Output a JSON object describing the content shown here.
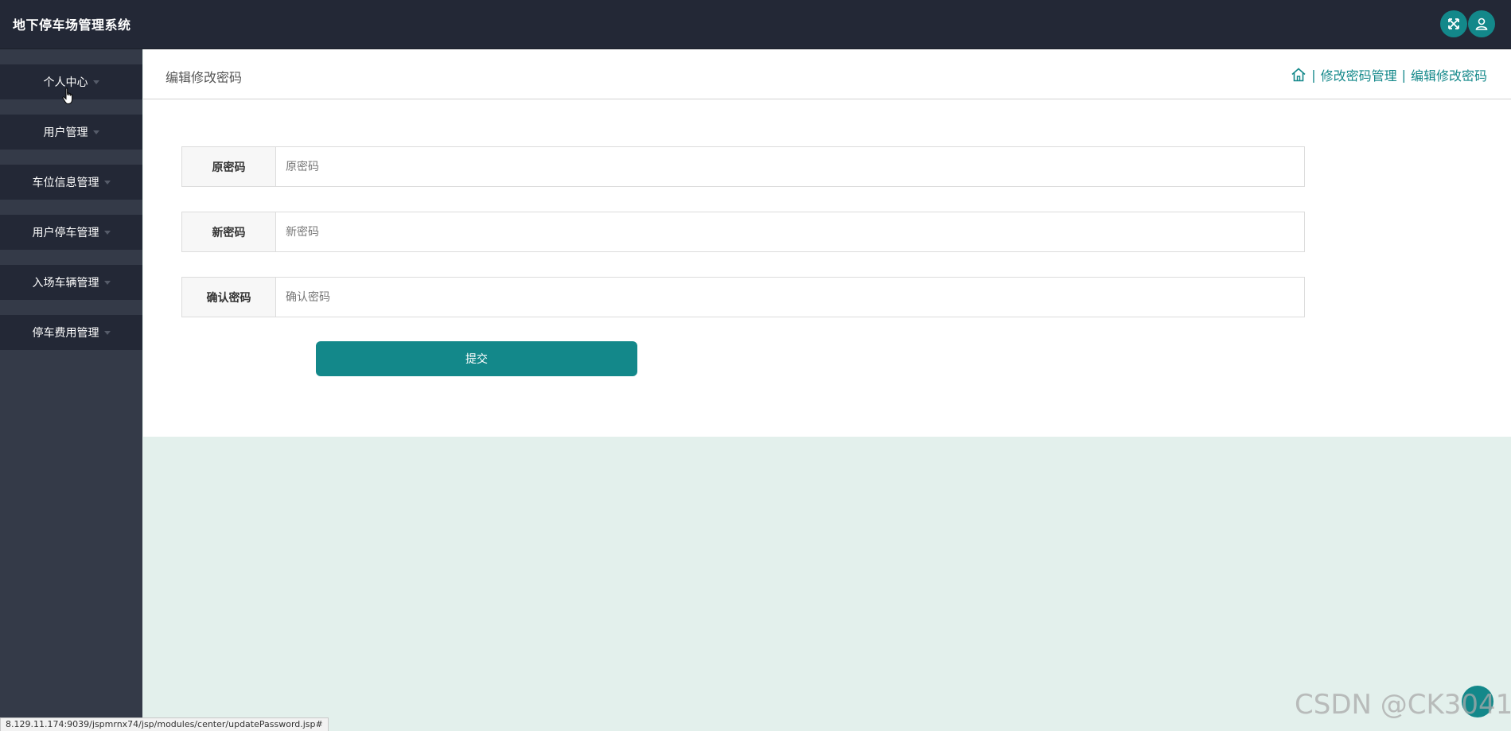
{
  "app": {
    "title": "地下停车场管理系统"
  },
  "header_actions": {
    "fullscreen_icon": "fullscreen-icon",
    "user_icon": "user-icon"
  },
  "sidebar": {
    "items": [
      {
        "label": "个人中心"
      },
      {
        "label": "用户管理"
      },
      {
        "label": "车位信息管理"
      },
      {
        "label": "用户停车管理"
      },
      {
        "label": "入场车辆管理"
      },
      {
        "label": "停车费用管理"
      }
    ]
  },
  "main": {
    "page_title": "编辑修改密码",
    "breadcrumb": {
      "home_icon": "home-icon",
      "items": [
        "修改密码管理",
        "编辑修改密码"
      ],
      "separator": "|"
    }
  },
  "form": {
    "fields": [
      {
        "label": "原密码",
        "placeholder": "原密码",
        "value": ""
      },
      {
        "label": "新密码",
        "placeholder": "新密码",
        "value": ""
      },
      {
        "label": "确认密码",
        "placeholder": "确认密码",
        "value": ""
      }
    ],
    "submit_label": "提交"
  },
  "status_bar": {
    "url": "8.129.11.174:9039/jspmrnx74/jsp/modules/center/updatePassword.jsp#"
  },
  "watermark": {
    "text": "CSDN @CK3041"
  },
  "colors": {
    "accent": "#13888a",
    "topbar": "#232836",
    "sidebar": "#343a48",
    "page_bg": "#e3f0ec"
  }
}
